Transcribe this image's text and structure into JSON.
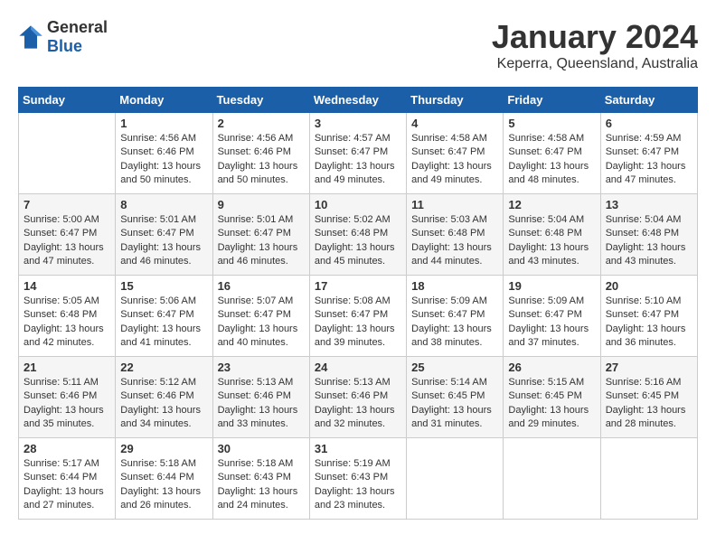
{
  "header": {
    "logo_general": "General",
    "logo_blue": "Blue",
    "month_year": "January 2024",
    "location": "Keperra, Queensland, Australia"
  },
  "weekdays": [
    "Sunday",
    "Monday",
    "Tuesday",
    "Wednesday",
    "Thursday",
    "Friday",
    "Saturday"
  ],
  "weeks": [
    [
      {
        "day": "",
        "info": ""
      },
      {
        "day": "1",
        "info": "Sunrise: 4:56 AM\nSunset: 6:46 PM\nDaylight: 13 hours\nand 50 minutes."
      },
      {
        "day": "2",
        "info": "Sunrise: 4:56 AM\nSunset: 6:46 PM\nDaylight: 13 hours\nand 50 minutes."
      },
      {
        "day": "3",
        "info": "Sunrise: 4:57 AM\nSunset: 6:47 PM\nDaylight: 13 hours\nand 49 minutes."
      },
      {
        "day": "4",
        "info": "Sunrise: 4:58 AM\nSunset: 6:47 PM\nDaylight: 13 hours\nand 49 minutes."
      },
      {
        "day": "5",
        "info": "Sunrise: 4:58 AM\nSunset: 6:47 PM\nDaylight: 13 hours\nand 48 minutes."
      },
      {
        "day": "6",
        "info": "Sunrise: 4:59 AM\nSunset: 6:47 PM\nDaylight: 13 hours\nand 47 minutes."
      }
    ],
    [
      {
        "day": "7",
        "info": "Sunrise: 5:00 AM\nSunset: 6:47 PM\nDaylight: 13 hours\nand 47 minutes."
      },
      {
        "day": "8",
        "info": "Sunrise: 5:01 AM\nSunset: 6:47 PM\nDaylight: 13 hours\nand 46 minutes."
      },
      {
        "day": "9",
        "info": "Sunrise: 5:01 AM\nSunset: 6:47 PM\nDaylight: 13 hours\nand 46 minutes."
      },
      {
        "day": "10",
        "info": "Sunrise: 5:02 AM\nSunset: 6:48 PM\nDaylight: 13 hours\nand 45 minutes."
      },
      {
        "day": "11",
        "info": "Sunrise: 5:03 AM\nSunset: 6:48 PM\nDaylight: 13 hours\nand 44 minutes."
      },
      {
        "day": "12",
        "info": "Sunrise: 5:04 AM\nSunset: 6:48 PM\nDaylight: 13 hours\nand 43 minutes."
      },
      {
        "day": "13",
        "info": "Sunrise: 5:04 AM\nSunset: 6:48 PM\nDaylight: 13 hours\nand 43 minutes."
      }
    ],
    [
      {
        "day": "14",
        "info": "Sunrise: 5:05 AM\nSunset: 6:48 PM\nDaylight: 13 hours\nand 42 minutes."
      },
      {
        "day": "15",
        "info": "Sunrise: 5:06 AM\nSunset: 6:47 PM\nDaylight: 13 hours\nand 41 minutes."
      },
      {
        "day": "16",
        "info": "Sunrise: 5:07 AM\nSunset: 6:47 PM\nDaylight: 13 hours\nand 40 minutes."
      },
      {
        "day": "17",
        "info": "Sunrise: 5:08 AM\nSunset: 6:47 PM\nDaylight: 13 hours\nand 39 minutes."
      },
      {
        "day": "18",
        "info": "Sunrise: 5:09 AM\nSunset: 6:47 PM\nDaylight: 13 hours\nand 38 minutes."
      },
      {
        "day": "19",
        "info": "Sunrise: 5:09 AM\nSunset: 6:47 PM\nDaylight: 13 hours\nand 37 minutes."
      },
      {
        "day": "20",
        "info": "Sunrise: 5:10 AM\nSunset: 6:47 PM\nDaylight: 13 hours\nand 36 minutes."
      }
    ],
    [
      {
        "day": "21",
        "info": "Sunrise: 5:11 AM\nSunset: 6:46 PM\nDaylight: 13 hours\nand 35 minutes."
      },
      {
        "day": "22",
        "info": "Sunrise: 5:12 AM\nSunset: 6:46 PM\nDaylight: 13 hours\nand 34 minutes."
      },
      {
        "day": "23",
        "info": "Sunrise: 5:13 AM\nSunset: 6:46 PM\nDaylight: 13 hours\nand 33 minutes."
      },
      {
        "day": "24",
        "info": "Sunrise: 5:13 AM\nSunset: 6:46 PM\nDaylight: 13 hours\nand 32 minutes."
      },
      {
        "day": "25",
        "info": "Sunrise: 5:14 AM\nSunset: 6:45 PM\nDaylight: 13 hours\nand 31 minutes."
      },
      {
        "day": "26",
        "info": "Sunrise: 5:15 AM\nSunset: 6:45 PM\nDaylight: 13 hours\nand 29 minutes."
      },
      {
        "day": "27",
        "info": "Sunrise: 5:16 AM\nSunset: 6:45 PM\nDaylight: 13 hours\nand 28 minutes."
      }
    ],
    [
      {
        "day": "28",
        "info": "Sunrise: 5:17 AM\nSunset: 6:44 PM\nDaylight: 13 hours\nand 27 minutes."
      },
      {
        "day": "29",
        "info": "Sunrise: 5:18 AM\nSunset: 6:44 PM\nDaylight: 13 hours\nand 26 minutes."
      },
      {
        "day": "30",
        "info": "Sunrise: 5:18 AM\nSunset: 6:43 PM\nDaylight: 13 hours\nand 24 minutes."
      },
      {
        "day": "31",
        "info": "Sunrise: 5:19 AM\nSunset: 6:43 PM\nDaylight: 13 hours\nand 23 minutes."
      },
      {
        "day": "",
        "info": ""
      },
      {
        "day": "",
        "info": ""
      },
      {
        "day": "",
        "info": ""
      }
    ]
  ]
}
